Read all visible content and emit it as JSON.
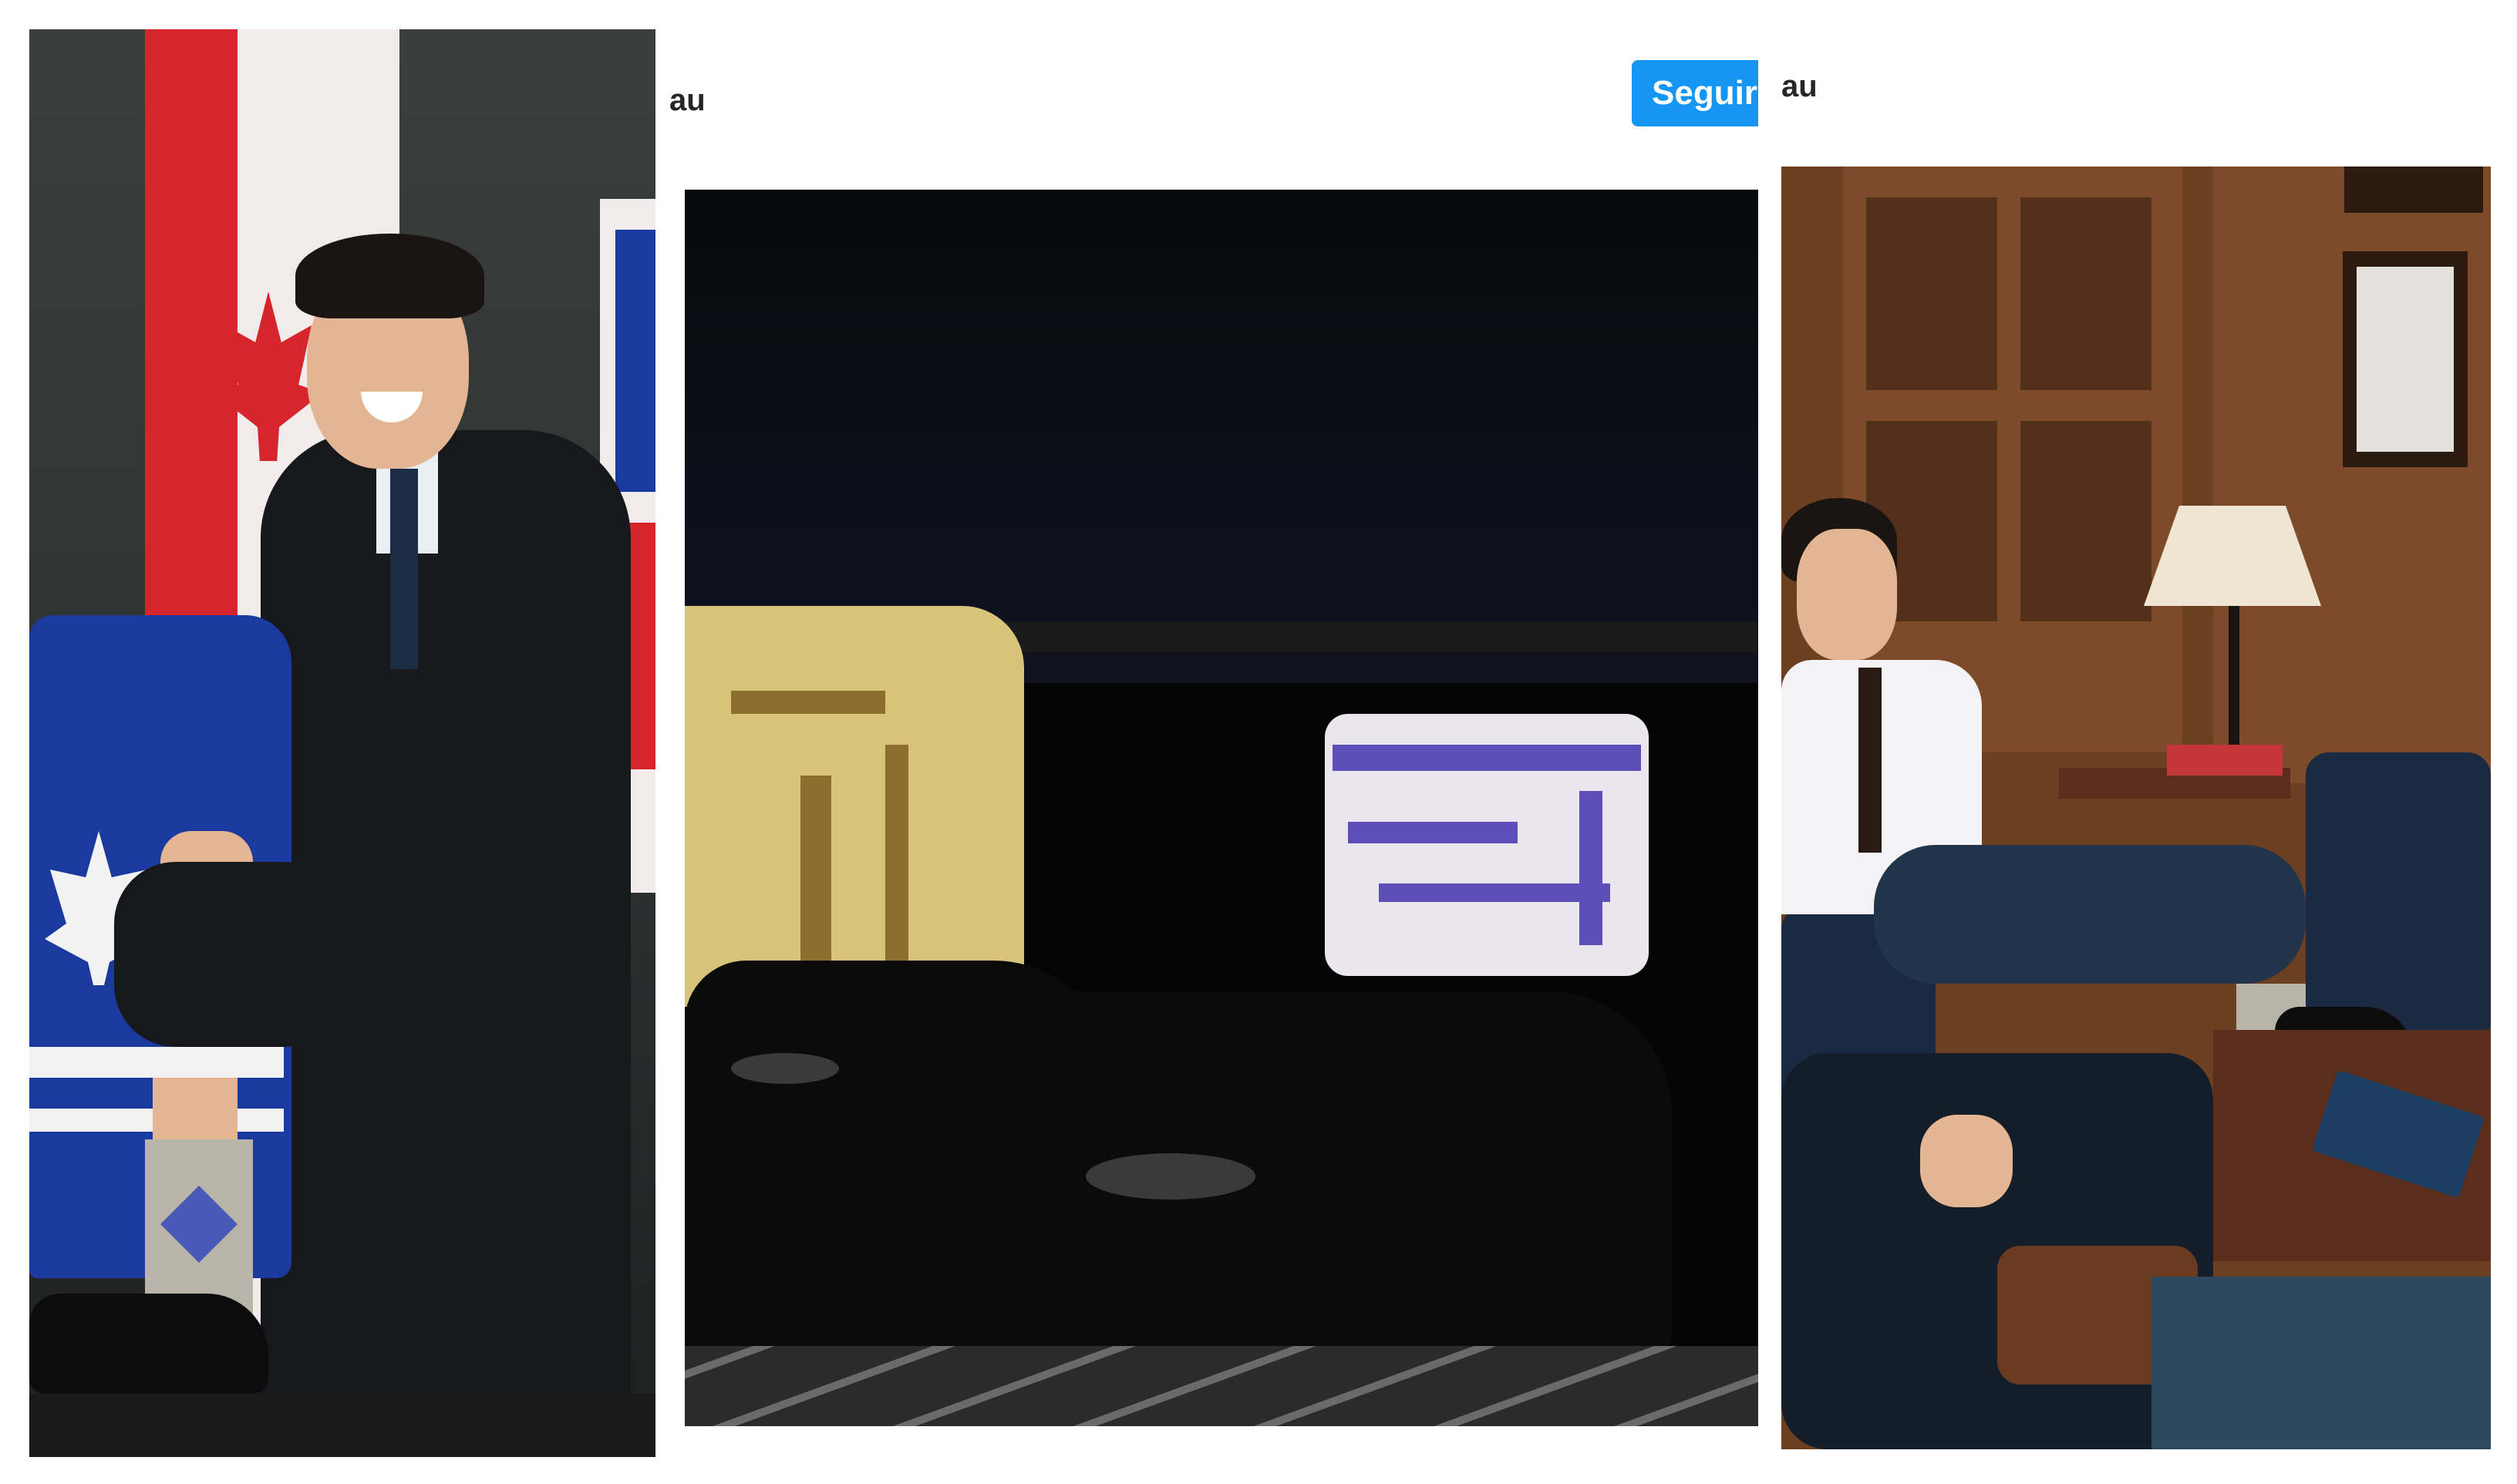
{
  "panel_2": {
    "account_name_fragment": "au",
    "follow_button_label": "Seguir"
  },
  "panel_3": {
    "account_name_fragment": "au"
  },
  "colors": {
    "follow_button": "#1596f5",
    "page_background": "#ffffff"
  }
}
